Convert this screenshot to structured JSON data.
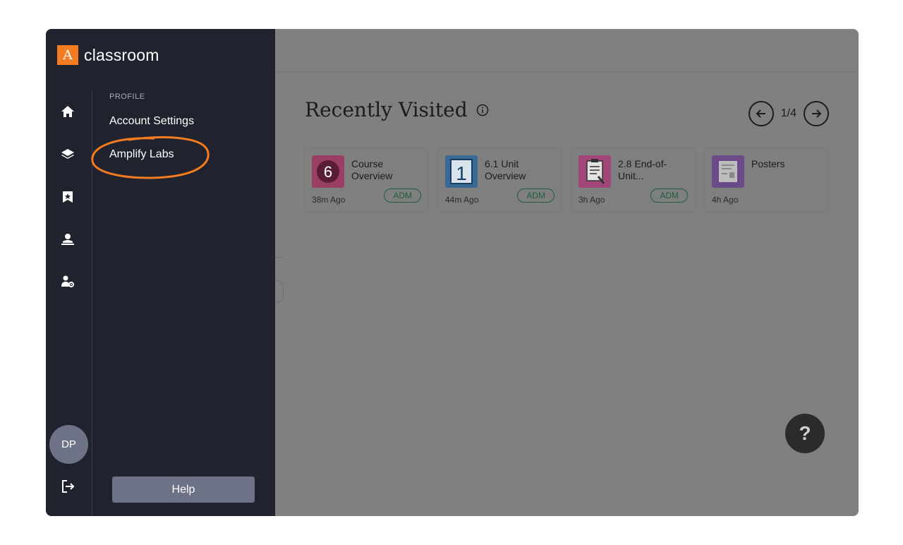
{
  "app": {
    "logo_letter": "A",
    "logo_text": "classroom",
    "accent": "#f47b20"
  },
  "rail": {
    "icons": [
      "home-icon",
      "layers-icon",
      "bookmark-star-icon",
      "teacher-icon",
      "user-settings-icon"
    ],
    "avatar_initials": "DP",
    "logout_icon": "logout-icon"
  },
  "menu": {
    "section_label": "PROFILE",
    "items": [
      {
        "label": "Account Settings"
      },
      {
        "label": "Amplify Labs"
      }
    ],
    "help_label": "Help"
  },
  "main": {
    "title": "Recently Visited",
    "pager": {
      "current_of_total": "1/4"
    },
    "cards": [
      {
        "title": "Course Overview",
        "time": "38m Ago",
        "badge": "ADM",
        "thumb_color": "#c12a63",
        "thumb_text": "6"
      },
      {
        "title": "6.1 Unit Overview",
        "time": "44m Ago",
        "badge": "ADM",
        "thumb_color": "#2b7bbf",
        "thumb_text": "1"
      },
      {
        "title": "2.8 End-of-Unit...",
        "time": "3h Ago",
        "badge": "ADM",
        "thumb_color": "#d4378a",
        "thumb_text": ""
      },
      {
        "title": "Posters",
        "time": "4h Ago",
        "badge": "",
        "thumb_color": "#7a3fb0",
        "thumb_text": ""
      }
    ],
    "help_fab": "?"
  }
}
